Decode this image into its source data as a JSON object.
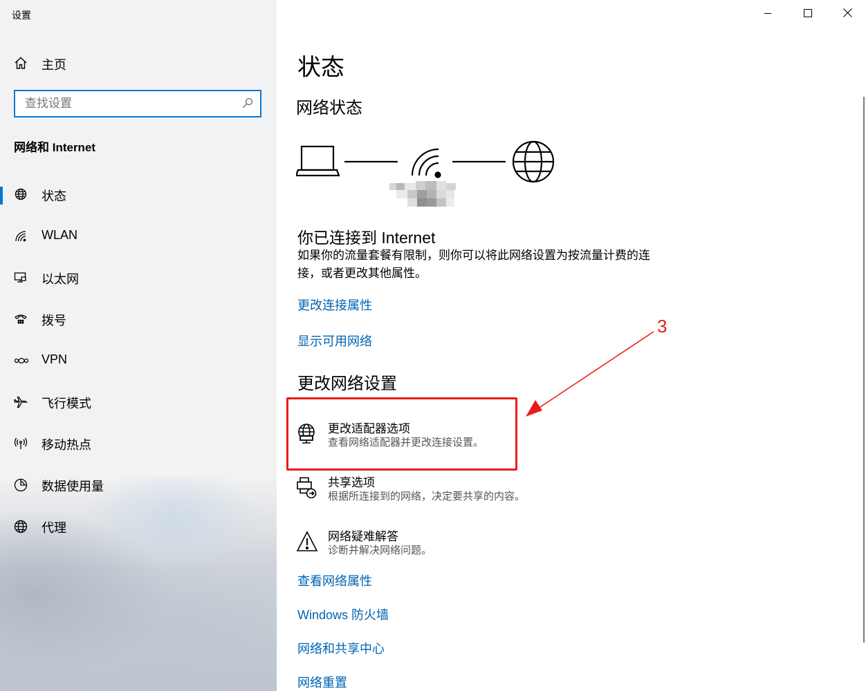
{
  "window": {
    "title": "设置",
    "controls": {
      "minimize": "minimize-icon",
      "maximize": "maximize-icon",
      "close": "close-icon"
    }
  },
  "sidebar": {
    "home_label": "主页",
    "search_placeholder": "查找设置",
    "section_title": "网络和 Internet",
    "items": [
      {
        "label": "状态",
        "icon": "globe-status-icon",
        "selected": true
      },
      {
        "label": "WLAN",
        "icon": "wifi-icon"
      },
      {
        "label": "以太网",
        "icon": "ethernet-icon"
      },
      {
        "label": "拨号",
        "icon": "dialup-icon"
      },
      {
        "label": "VPN",
        "icon": "vpn-icon"
      },
      {
        "label": "飞行模式",
        "icon": "airplane-icon"
      },
      {
        "label": "移动热点",
        "icon": "hotspot-icon"
      },
      {
        "label": "数据使用量",
        "icon": "data-usage-icon"
      },
      {
        "label": "代理",
        "icon": "globe-icon"
      }
    ]
  },
  "main": {
    "title": "状态",
    "network_status_heading": "网络状态",
    "connected_title": "你已连接到 Internet",
    "connected_desc": "如果你的流量套餐有限制，则你可以将此网络设置为按流量计费的连接，或者更改其他属性。",
    "links_top": [
      "更改连接属性",
      "显示可用网络"
    ],
    "change_settings_heading": "更改网络设置",
    "options": [
      {
        "title": "更改适配器选项",
        "desc": "查看网络适配器并更改连接设置。",
        "icon": "adapter-globe-icon"
      },
      {
        "title": "共享选项",
        "desc": "根据所连接到的网络，决定要共享的内容。",
        "icon": "sharing-icon"
      },
      {
        "title": "网络疑难解答",
        "desc": "诊断并解决网络问题。",
        "icon": "warning-icon"
      }
    ],
    "links_bottom": [
      "查看网络属性",
      "Windows 防火墙",
      "网络和共享中心",
      "网络重置"
    ]
  },
  "annotation": {
    "label": "3",
    "color": "#e81b1b"
  },
  "colors": {
    "accent": "#0078d7",
    "link": "#0063b1",
    "annotation": "#e81b1b"
  }
}
